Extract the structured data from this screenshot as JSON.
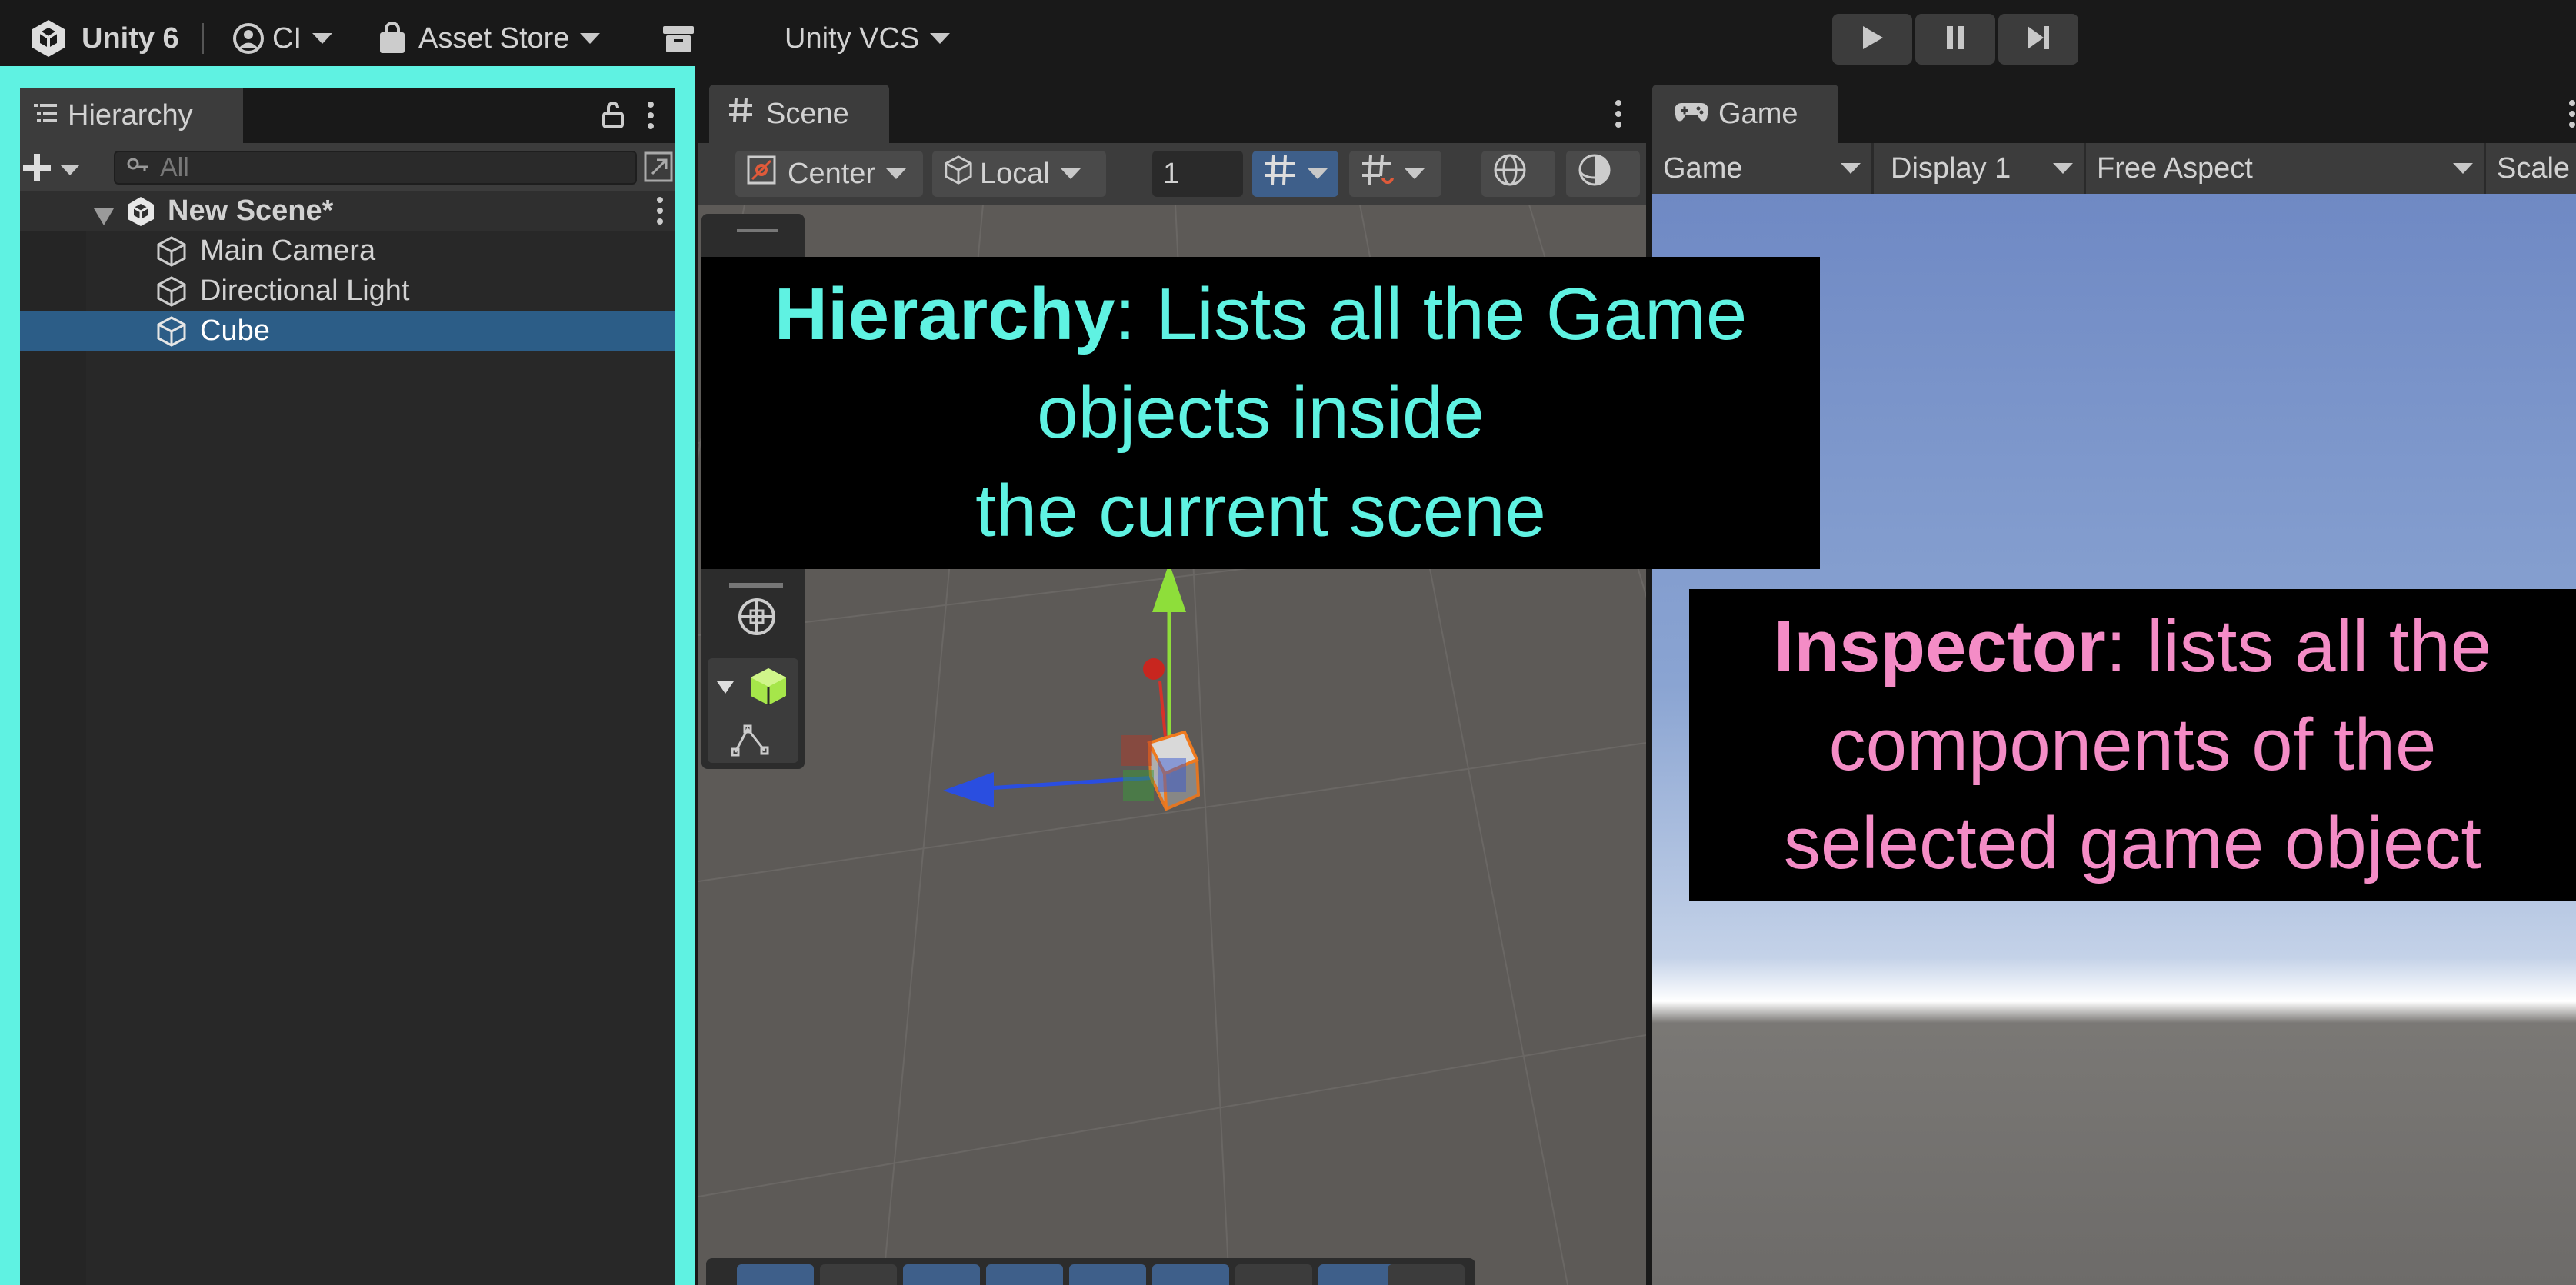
{
  "topbar": {
    "app_name": "Unity 6",
    "account_label": "CI",
    "asset_store_label": "Asset Store",
    "vcs_label": "Unity VCS"
  },
  "hierarchy": {
    "tab_label": "Hierarchy",
    "search_placeholder": "All",
    "scene_name": "New Scene*",
    "objects": [
      "Main Camera",
      "Directional Light",
      "Cube"
    ],
    "selected_object": "Cube"
  },
  "scene": {
    "tab_label": "Scene",
    "pivot_mode": "Center",
    "pivot_rotation": "Local",
    "grid_snap_value": "1"
  },
  "game": {
    "tab_label": "Game",
    "view_mode": "Game",
    "display": "Display 1",
    "aspect": "Free Aspect",
    "scale_label": "Scale"
  },
  "callouts": {
    "hierarchy_title": "Hierarchy",
    "hierarchy_line1": ": Lists all the Game",
    "hierarchy_line2": "objects inside",
    "hierarchy_line3": "the current scene",
    "inspector_title": "Inspector",
    "inspector_line1": ": lists all the",
    "inspector_line2": "components of the",
    "inspector_line3": "selected game object"
  },
  "colors": {
    "hierarchy_highlight": "#5ff2e2",
    "inspector_text": "#f48cc6",
    "selection": "#2c5d87"
  },
  "icons": [
    "unity-logo-icon",
    "account-icon",
    "shopping-bag-icon",
    "archive-icon",
    "play-icon",
    "pause-icon",
    "step-icon",
    "hierarchy-list-icon",
    "lock-icon",
    "kebab-menu-icon",
    "plus-icon",
    "search-icon",
    "unity-scene-icon",
    "cube-outline-icon",
    "grid-hash-icon",
    "gamepad-icon"
  ]
}
